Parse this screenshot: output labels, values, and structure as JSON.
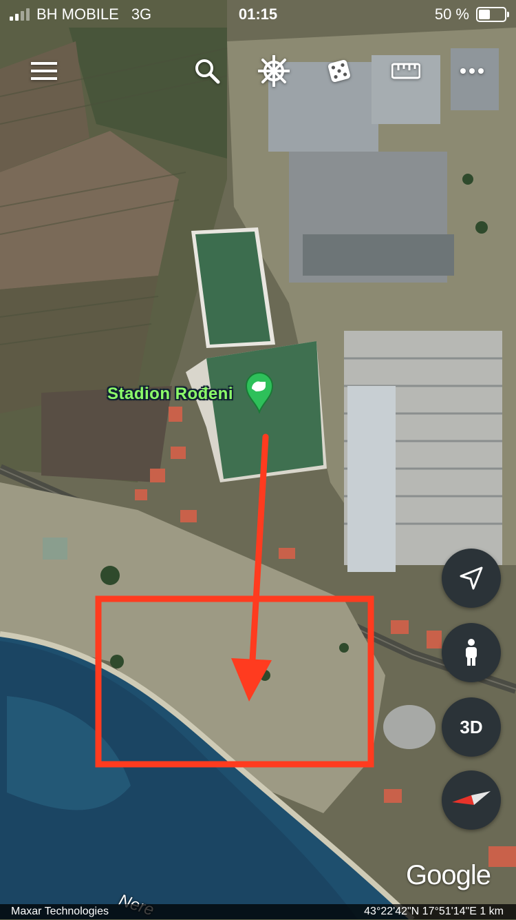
{
  "status_bar": {
    "carrier": "BH MOBILE",
    "network": "3G",
    "time": "01:15",
    "battery_percent": "50 %",
    "battery_level": 0.5,
    "signal_bars_filled": 2,
    "signal_bars_total": 4
  },
  "toolbar": {
    "menu_icon": "hamburger-menu-icon",
    "search_icon": "search-icon",
    "voyager_icon": "ship-wheel-icon",
    "random_icon": "dice-icon",
    "measure_icon": "ruler-icon",
    "more_icon": "more-horizontal-icon"
  },
  "map": {
    "place_label": "Stadion Rođeni",
    "place_icon": "stadium-pin-icon",
    "road_label": "Nere",
    "annotation_color": "#ff3b1f",
    "pin_color": "#2ec05a"
  },
  "controls": {
    "locate_icon": "navigation-arrow-icon",
    "streetview_icon": "pegman-icon",
    "view_3d_label": "3D",
    "compass_icon": "compass-icon"
  },
  "branding": {
    "logo_text": "Google"
  },
  "footer": {
    "attribution": "Maxar Technologies",
    "coordinates": "43°22'42\"N 17°51'14\"E 1 km"
  }
}
